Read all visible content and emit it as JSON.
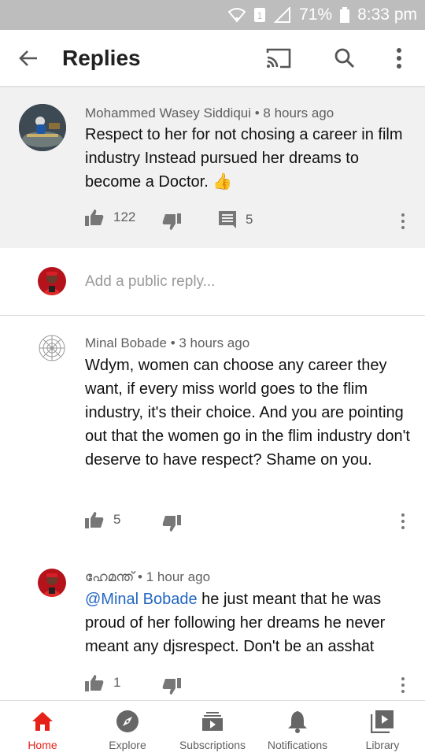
{
  "status_bar": {
    "battery": "71%",
    "time": "8:33 pm"
  },
  "header": {
    "title": "Replies"
  },
  "parent_comment": {
    "author": "Mohammed Wasey Siddiqui",
    "time": "8 hours ago",
    "text": "Respect to her for not chosing a career in film industry Instead pursued her dreams to become a Doctor. 👍",
    "likes": "122",
    "replies": "5"
  },
  "reply_box": {
    "placeholder": "Add a public reply..."
  },
  "replies": [
    {
      "author": "Minal Bobade",
      "time": "3 hours ago",
      "text": "Wdym, women can choose any career they want, if every miss world goes to the flim industry, it's their choice. And you are pointing out that the women go in the flim industry don't deserve to have respect? Shame on you.",
      "likes": "5"
    },
    {
      "author": "ഹേമന്ത്",
      "time": "1 hour ago",
      "mention": "@Minal Bobade",
      "text": " he just meant that he was proud of her following her dreams he never meant any djsrespect.  Don't  be an asshat",
      "likes": "1"
    }
  ],
  "meta_separator": " • ",
  "bottom_nav": [
    {
      "label": "Home",
      "icon": "home-icon",
      "active": true
    },
    {
      "label": "Explore",
      "icon": "compass-icon"
    },
    {
      "label": "Subscriptions",
      "icon": "subscriptions-icon"
    },
    {
      "label": "Notifications",
      "icon": "bell-icon"
    },
    {
      "label": "Library",
      "icon": "library-icon"
    }
  ],
  "colors": {
    "accent": "#e62117",
    "link": "#2266c2",
    "status_bar": "#bdbdbd",
    "parent_bg": "#f1f1f1"
  }
}
